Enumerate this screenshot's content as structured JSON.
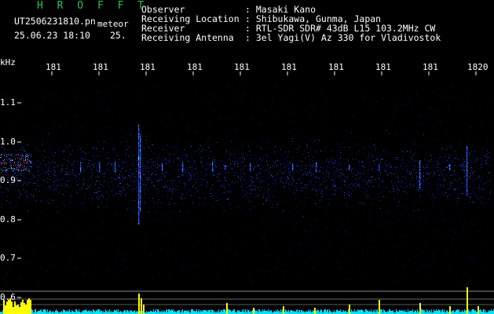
{
  "header": {
    "program": "H R O F F T",
    "filename": "UT2506231810.pn",
    "type_tag": "meteor",
    "datetime": "25.06.23 18:10",
    "interval": "25.",
    "info": [
      {
        "label": "Observer",
        "value": ": Masaki Kano"
      },
      {
        "label": "Receiving Location",
        "value": ": Shibukawa, Gunma, Japan"
      },
      {
        "label": "Receiver",
        "value": ": RTL-SDR SDR# 43dB L15 103.2MHz CW"
      },
      {
        "label": "Receiving Antenna",
        "value": ": 3el Yagi(V) Az 330 for Vladivostok"
      }
    ]
  },
  "axes": {
    "y_unit": "kHz",
    "y_ticks": [
      "1.1",
      "1.0",
      "0.9",
      "0.8",
      "0.7",
      "0.6"
    ],
    "x_ticks": [
      "181",
      "181",
      "181",
      "181",
      "181",
      "181",
      "181",
      "181",
      "181",
      "1820"
    ]
  },
  "colors": {
    "title_green": "#22c55e",
    "background": "#000000",
    "text": "#ffffff",
    "signal_level": "#ffff00",
    "noise_level": "#00ffff"
  }
}
